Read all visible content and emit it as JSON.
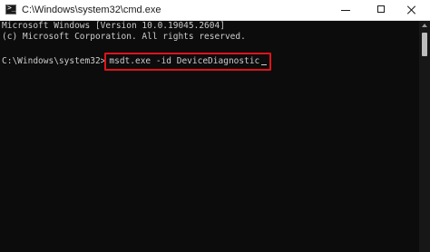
{
  "window": {
    "title": "C:\\Windows\\system32\\cmd.exe",
    "icon": "cmd-icon",
    "prompt_glyph": ">_"
  },
  "controls": {
    "minimize_icon": "minimize-icon",
    "maximize_icon": "maximize-icon",
    "close_icon": "close-icon"
  },
  "console": {
    "header_line_1": "Microsoft Windows [Version 10.0.19045.2604]",
    "header_line_2": "(c) Microsoft Corporation. All rights reserved.",
    "prompt": "C:\\Windows\\system32>",
    "command": "msdt.exe -id DeviceDiagnostic"
  },
  "colors": {
    "background": "#0c0c0c",
    "text": "#cccccc",
    "highlight_box": "#e0121b",
    "titlebar": "#ffffff"
  }
}
